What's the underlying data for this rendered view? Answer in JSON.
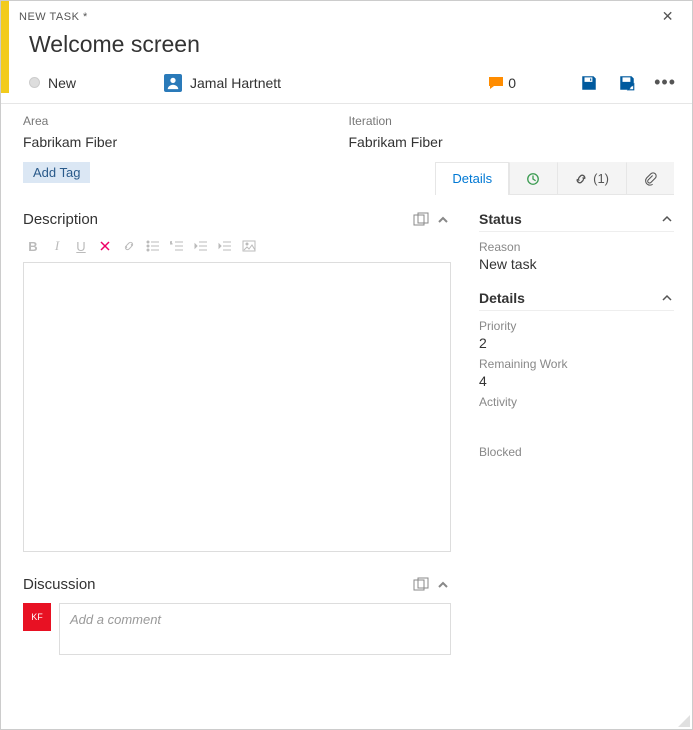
{
  "header": {
    "type_label": "NEW TASK *",
    "title": "Welcome screen",
    "state": "New",
    "assignee": "Jamal Hartnett",
    "comment_count": "0"
  },
  "fields": {
    "area_label": "Area",
    "area_value": "Fabrikam Fiber",
    "iteration_label": "Iteration",
    "iteration_value": "Fabrikam Fiber"
  },
  "tags": {
    "add_label": "Add Tag"
  },
  "tabs": {
    "details": "Details",
    "links_count": "(1)"
  },
  "sections": {
    "description": "Description",
    "discussion": "Discussion"
  },
  "discussion": {
    "avatar_initials": "KF",
    "placeholder": "Add a comment"
  },
  "right": {
    "status": {
      "title": "Status",
      "reason_label": "Reason",
      "reason_value": "New task"
    },
    "details": {
      "title": "Details",
      "priority_label": "Priority",
      "priority_value": "2",
      "remaining_label": "Remaining Work",
      "remaining_value": "4",
      "activity_label": "Activity",
      "blocked_label": "Blocked"
    }
  }
}
